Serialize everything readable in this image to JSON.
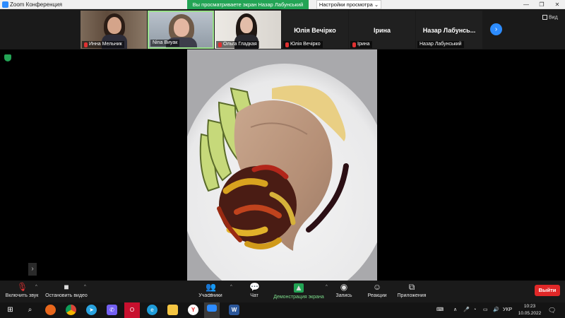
{
  "window": {
    "title": "Zoom Конференция",
    "share_banner": "Вы просматриваете экран Назар Лабунський",
    "view_settings": "Настройки просмотра",
    "minimize": "—",
    "maximize": "❐",
    "close": "✕"
  },
  "gallery": {
    "view_label": "Вид",
    "next_icon": "chevron-right-icon",
    "participants": [
      {
        "name": "Инна Мельник",
        "has_video": true,
        "muted": true,
        "active": false
      },
      {
        "name": "Nina Виуак",
        "has_video": true,
        "muted": false,
        "active": true
      },
      {
        "name": "Ольга Гладкая",
        "has_video": true,
        "muted": true,
        "active": false
      },
      {
        "name": "Юлія Вечірко",
        "display": "Юлія Вечірко",
        "has_video": false,
        "muted": true,
        "active": false
      },
      {
        "name": "Ірина",
        "display": "Ірина",
        "has_video": false,
        "muted": true,
        "active": false
      },
      {
        "name": "Назар Лабунський",
        "display": "Назар Лабунсь...",
        "has_video": false,
        "muted": false,
        "active": false
      }
    ]
  },
  "toolbar": {
    "audio": "Включить звук",
    "video": "Остановить видео",
    "participants": "Участники",
    "participants_count": "16",
    "chat": "Чат",
    "share": "Демонстрация экрана",
    "record": "Запись",
    "reactions": "Реакции",
    "apps": "Приложения",
    "leave": "Выйти"
  },
  "taskbar": {
    "language": "УКР",
    "time": "10:23",
    "date": "10.05.2022"
  },
  "colors": {
    "zoom_blue": "#2d8cff",
    "share_green": "#23a455",
    "leave_red": "#e02828"
  }
}
